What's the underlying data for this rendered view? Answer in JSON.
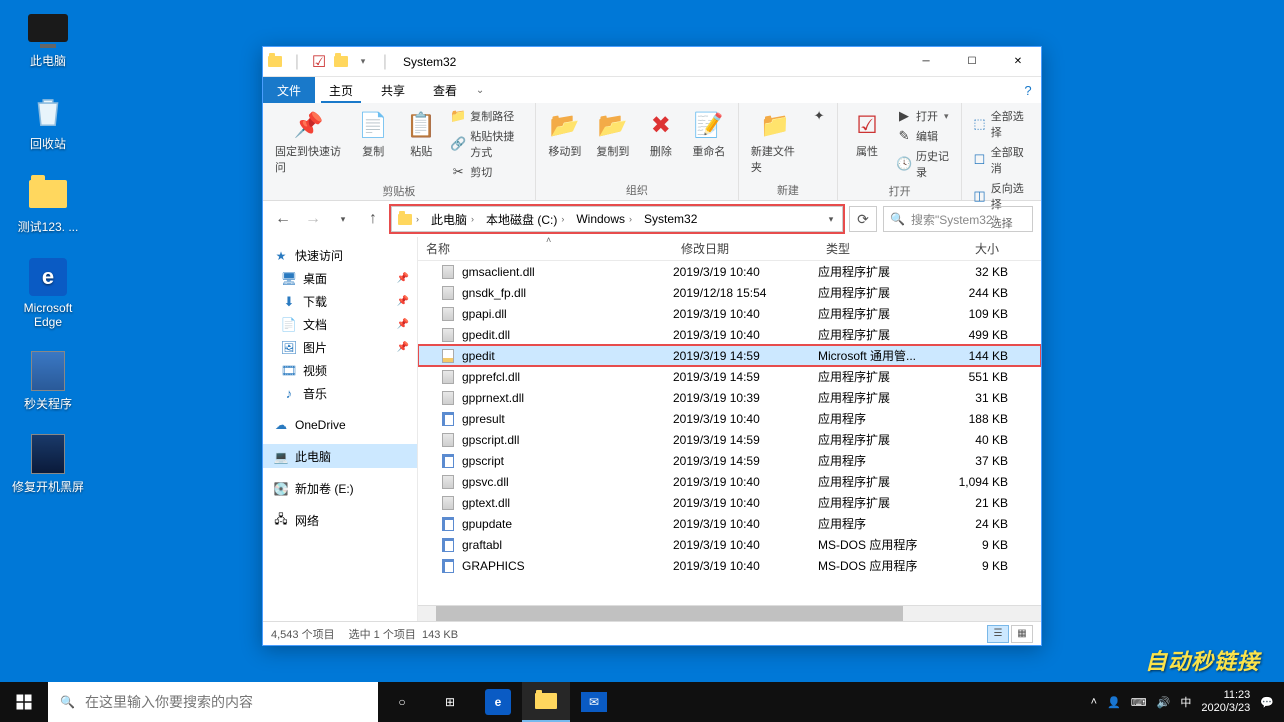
{
  "desktop": {
    "icons": [
      {
        "label": "此电脑",
        "icon": "pc"
      },
      {
        "label": "回收站",
        "icon": "bin"
      },
      {
        "label": "测试123. ...",
        "icon": "folder"
      },
      {
        "label": "Microsoft Edge",
        "icon": "edge"
      },
      {
        "label": "秒关程序",
        "icon": "app"
      },
      {
        "label": "修复开机黑屏",
        "icon": "app2"
      }
    ]
  },
  "window": {
    "title": "System32",
    "tabs": {
      "file": "文件",
      "home": "主页",
      "share": "共享",
      "view": "查看"
    },
    "ribbon": {
      "clipboard": {
        "pin": "固定到快速访问",
        "copy": "复制",
        "paste": "粘贴",
        "copy_path": "复制路径",
        "paste_shortcut": "粘贴快捷方式",
        "cut": "剪切",
        "label": "剪贴板"
      },
      "organize": {
        "moveto": "移动到",
        "copyto": "复制到",
        "delete": "删除",
        "rename": "重命名",
        "label": "组织"
      },
      "new": {
        "newfolder": "新建文件夹",
        "label": "新建"
      },
      "open": {
        "properties": "属性",
        "open": "打开",
        "edit": "编辑",
        "history": "历史记录",
        "label": "打开"
      },
      "select": {
        "all": "全部选择",
        "none": "全部取消",
        "invert": "反向选择",
        "label": "选择"
      }
    },
    "nav": {
      "back": "←",
      "fwd": "→",
      "up": "↑"
    },
    "breadcrumbs": [
      "此电脑",
      "本地磁盘 (C:)",
      "Windows",
      "System32"
    ],
    "search_placeholder": "搜索\"System32\"",
    "navpane": {
      "quick": "快速访问",
      "items": [
        {
          "label": "桌面",
          "icon": "desktop",
          "pin": true
        },
        {
          "label": "下载",
          "icon": "download",
          "pin": true
        },
        {
          "label": "文档",
          "icon": "doc",
          "pin": true
        },
        {
          "label": "图片",
          "icon": "pic",
          "pin": true
        },
        {
          "label": "视频",
          "icon": "video",
          "pin": false
        },
        {
          "label": "音乐",
          "icon": "music",
          "pin": false
        }
      ],
      "onedrive": "OneDrive",
      "thispc": "此电脑",
      "volumes": [
        {
          "label": "新加卷 (E:)"
        }
      ],
      "network": "网络"
    },
    "columns": {
      "name": "名称",
      "date": "修改日期",
      "type": "类型",
      "size": "大小"
    },
    "files": [
      {
        "name": "gmsaclient.dll",
        "date": "2019/3/19 10:40",
        "type": "应用程序扩展",
        "size": "32 KB",
        "icon": "dll"
      },
      {
        "name": "gnsdk_fp.dll",
        "date": "2019/12/18 15:54",
        "type": "应用程序扩展",
        "size": "244 KB",
        "icon": "dll"
      },
      {
        "name": "gpapi.dll",
        "date": "2019/3/19 10:40",
        "type": "应用程序扩展",
        "size": "109 KB",
        "icon": "dll"
      },
      {
        "name": "gpedit.dll",
        "date": "2019/3/19 10:40",
        "type": "应用程序扩展",
        "size": "499 KB",
        "icon": "dll"
      },
      {
        "name": "gpedit",
        "date": "2019/3/19 14:59",
        "type": "Microsoft 通用管...",
        "size": "144 KB",
        "icon": "msc",
        "selected": true
      },
      {
        "name": "gpprefcl.dll",
        "date": "2019/3/19 14:59",
        "type": "应用程序扩展",
        "size": "551 KB",
        "icon": "dll"
      },
      {
        "name": "gpprnext.dll",
        "date": "2019/3/19 10:39",
        "type": "应用程序扩展",
        "size": "31 KB",
        "icon": "dll"
      },
      {
        "name": "gpresult",
        "date": "2019/3/19 10:40",
        "type": "应用程序",
        "size": "188 KB",
        "icon": "exe"
      },
      {
        "name": "gpscript.dll",
        "date": "2019/3/19 14:59",
        "type": "应用程序扩展",
        "size": "40 KB",
        "icon": "dll"
      },
      {
        "name": "gpscript",
        "date": "2019/3/19 14:59",
        "type": "应用程序",
        "size": "37 KB",
        "icon": "exe"
      },
      {
        "name": "gpsvc.dll",
        "date": "2019/3/19 10:40",
        "type": "应用程序扩展",
        "size": "1,094 KB",
        "icon": "dll"
      },
      {
        "name": "gptext.dll",
        "date": "2019/3/19 10:40",
        "type": "应用程序扩展",
        "size": "21 KB",
        "icon": "dll"
      },
      {
        "name": "gpupdate",
        "date": "2019/3/19 10:40",
        "type": "应用程序",
        "size": "24 KB",
        "icon": "exe"
      },
      {
        "name": "graftabl",
        "date": "2019/3/19 10:40",
        "type": "MS-DOS 应用程序",
        "size": "9 KB",
        "icon": "exe"
      },
      {
        "name": "GRAPHICS",
        "date": "2019/3/19 10:40",
        "type": "MS-DOS 应用程序",
        "size": "9 KB",
        "icon": "exe"
      }
    ],
    "status": {
      "count": "4,543 个项目",
      "selected": "选中 1 个项目",
      "size": "143 KB"
    }
  },
  "taskbar": {
    "search_placeholder": "在这里输入你要搜索的内容",
    "time": "11:23",
    "date": "2020/3/23"
  },
  "watermark": "自动秒链接"
}
